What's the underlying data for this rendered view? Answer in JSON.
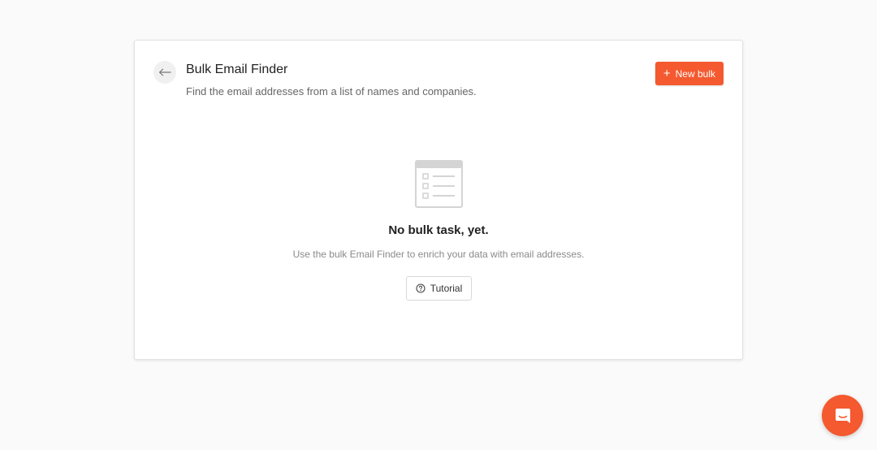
{
  "header": {
    "title": "Bulk Email Finder",
    "subtitle": "Find the email addresses from a list of names and companies.",
    "new_bulk_label": "New bulk",
    "back_icon": "arrow-left-icon",
    "new_icon": "plus-icon"
  },
  "empty_state": {
    "icon": "list-document-icon",
    "title": "No bulk task, yet.",
    "description": "Use the bulk Email Finder to enrich your data with email addresses.",
    "tutorial_label": "Tutorial",
    "tutorial_icon": "question-circle-icon"
  },
  "chat": {
    "icon": "chat-icon"
  },
  "colors": {
    "accent": "#f4592f",
    "background": "#fafafa",
    "card": "#ffffff"
  }
}
